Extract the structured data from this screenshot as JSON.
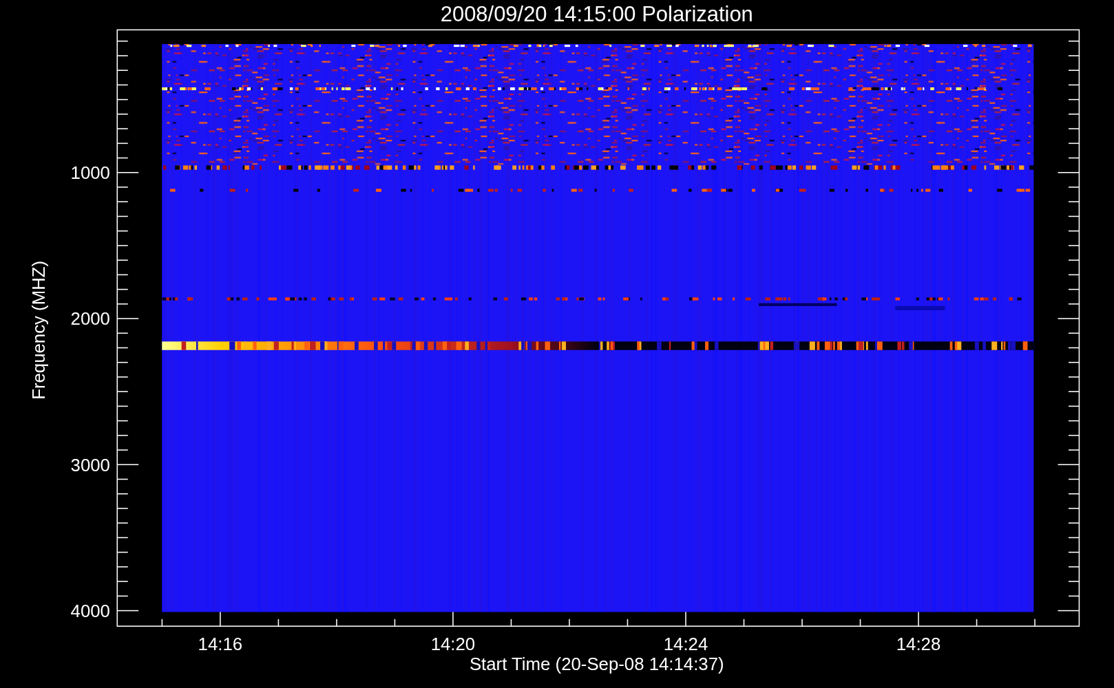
{
  "title": "2008/09/20 14:15:00 Polarization",
  "plot": {
    "ylabel": "Frequency (MHZ)",
    "xlabel": "Start Time (20-Sep-08 14:14:37)",
    "yticks": [
      "1000",
      "2000",
      "3000",
      "4000"
    ],
    "xticks": [
      "14:16",
      "14:20",
      "14:24",
      "14:28"
    ]
  }
}
